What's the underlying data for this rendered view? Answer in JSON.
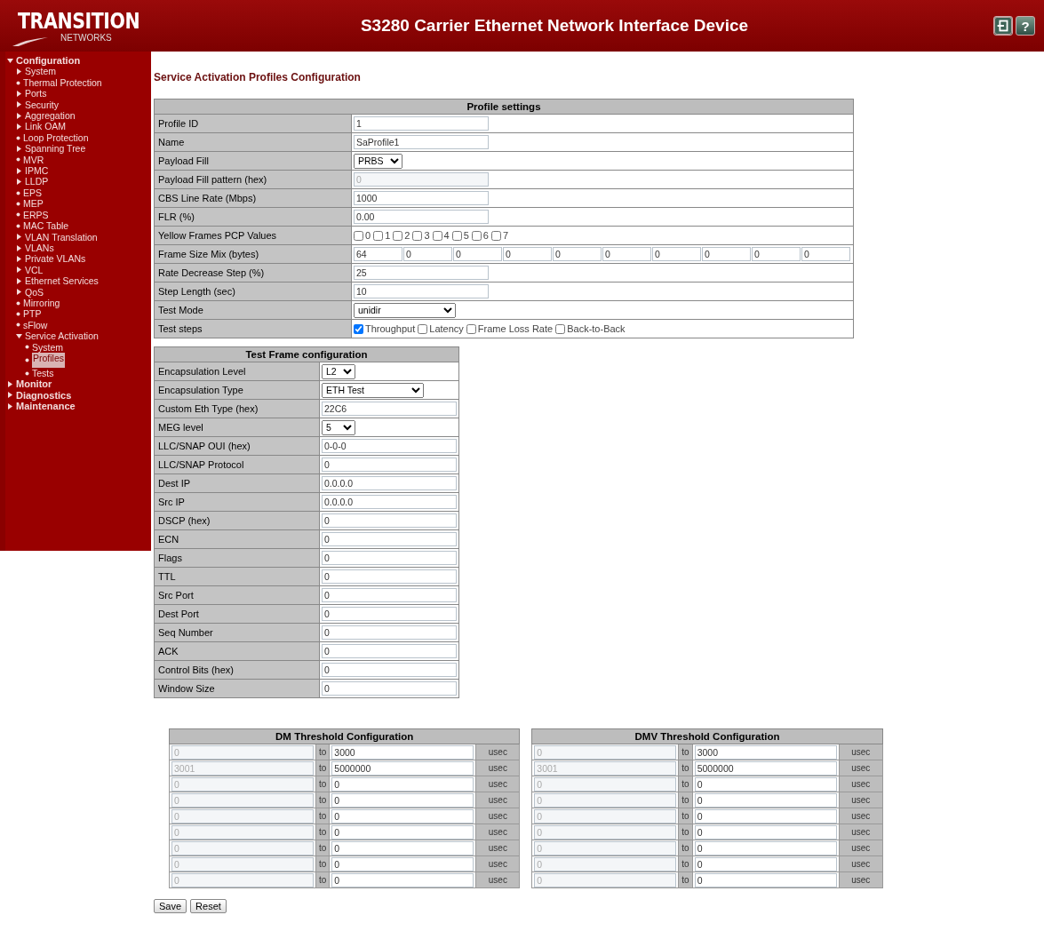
{
  "header": {
    "logo_main": "TRANSITION",
    "logo_sub": "NETWORKS",
    "title": "S3280 Carrier Ethernet Network Interface Device",
    "help": "?"
  },
  "sidebar": {
    "items": [
      {
        "label": "Configuration",
        "kind": "folder",
        "expanded": true,
        "selected": false,
        "children": [
          {
            "label": "System",
            "kind": "folder",
            "expanded": false,
            "selected": false
          },
          {
            "label": "Thermal Protection",
            "kind": "page",
            "selected": false
          },
          {
            "label": "Ports",
            "kind": "folder",
            "expanded": false,
            "selected": false
          },
          {
            "label": "Security",
            "kind": "folder",
            "expanded": false,
            "selected": false
          },
          {
            "label": "Aggregation",
            "kind": "folder",
            "expanded": false,
            "selected": false
          },
          {
            "label": "Link OAM",
            "kind": "folder",
            "expanded": false,
            "selected": false
          },
          {
            "label": "Loop Protection",
            "kind": "page",
            "selected": false
          },
          {
            "label": "Spanning Tree",
            "kind": "folder",
            "expanded": false,
            "selected": false
          },
          {
            "label": "MVR",
            "kind": "page",
            "selected": false
          },
          {
            "label": "IPMC",
            "kind": "folder",
            "expanded": false,
            "selected": false
          },
          {
            "label": "LLDP",
            "kind": "folder",
            "expanded": false,
            "selected": false
          },
          {
            "label": "EPS",
            "kind": "page",
            "selected": false
          },
          {
            "label": "MEP",
            "kind": "page",
            "selected": false
          },
          {
            "label": "ERPS",
            "kind": "page",
            "selected": false
          },
          {
            "label": "MAC Table",
            "kind": "page",
            "selected": false
          },
          {
            "label": "VLAN Translation",
            "kind": "folder",
            "expanded": false,
            "selected": false
          },
          {
            "label": "VLANs",
            "kind": "folder",
            "expanded": false,
            "selected": false
          },
          {
            "label": "Private VLANs",
            "kind": "folder",
            "expanded": false,
            "selected": false
          },
          {
            "label": "VCL",
            "kind": "folder",
            "expanded": false,
            "selected": false
          },
          {
            "label": "Ethernet Services",
            "kind": "folder",
            "expanded": false,
            "selected": false
          },
          {
            "label": "QoS",
            "kind": "folder",
            "expanded": false,
            "selected": false
          },
          {
            "label": "Mirroring",
            "kind": "page",
            "selected": false
          },
          {
            "label": "PTP",
            "kind": "page",
            "selected": false
          },
          {
            "label": "sFlow",
            "kind": "page",
            "selected": false
          },
          {
            "label": "Service Activation",
            "kind": "folder",
            "expanded": true,
            "selected": false,
            "children": [
              {
                "label": "System",
                "kind": "page",
                "selected": false
              },
              {
                "label": "Profiles",
                "kind": "page",
                "selected": true
              },
              {
                "label": "Tests",
                "kind": "page",
                "selected": false
              }
            ]
          }
        ]
      },
      {
        "label": "Monitor",
        "kind": "folder",
        "expanded": false,
        "selected": false
      },
      {
        "label": "Diagnostics",
        "kind": "folder",
        "expanded": false,
        "selected": false
      },
      {
        "label": "Maintenance",
        "kind": "folder",
        "expanded": false,
        "selected": false
      }
    ]
  },
  "page_title": "Service Activation Profiles Configuration",
  "profile": {
    "title": "Profile settings",
    "rows": [
      {
        "kind": "text",
        "label": "Profile ID",
        "value": "1",
        "disabled": false
      },
      {
        "kind": "text",
        "label": "Name",
        "value": "SaProfile1",
        "disabled": false
      },
      {
        "kind": "select",
        "label": "Payload Fill",
        "value": "PRBS"
      },
      {
        "kind": "text",
        "label": "Payload Fill pattern (hex)",
        "value": "0",
        "disabled": true
      },
      {
        "kind": "text",
        "label": "CBS Line Rate (Mbps)",
        "value": "1000",
        "disabled": false
      },
      {
        "kind": "text",
        "label": "FLR (%)",
        "value": "0.00",
        "disabled": false
      },
      {
        "kind": "checks",
        "label": "Yellow Frames PCP Values",
        "options": [
          {
            "label": "0",
            "checked": false
          },
          {
            "label": "1",
            "checked": false
          },
          {
            "label": "2",
            "checked": false
          },
          {
            "label": "3",
            "checked": false
          },
          {
            "label": "4",
            "checked": false
          },
          {
            "label": "5",
            "checked": false
          },
          {
            "label": "6",
            "checked": false
          },
          {
            "label": "7",
            "checked": false
          }
        ]
      },
      {
        "kind": "multi",
        "label": "Frame Size Mix (bytes)",
        "values": [
          "64",
          "0",
          "0",
          "0",
          "0",
          "0",
          "0",
          "0",
          "0",
          "0"
        ]
      },
      {
        "kind": "text",
        "label": "Rate Decrease Step (%)",
        "value": "25",
        "disabled": false
      },
      {
        "kind": "text",
        "label": "Step Length (sec)",
        "value": "10",
        "disabled": false
      },
      {
        "kind": "select",
        "label": "Test Mode",
        "value": "unidir"
      },
      {
        "kind": "checks",
        "label": "Test steps",
        "options": [
          {
            "label": "Throughput",
            "checked": true
          },
          {
            "label": "Latency",
            "checked": false
          },
          {
            "label": "Frame Loss Rate",
            "checked": false
          },
          {
            "label": "Back-to-Back",
            "checked": false
          }
        ]
      }
    ]
  },
  "test_frame": {
    "title": "Test Frame configuration",
    "rows": [
      {
        "kind": "select",
        "label": "Encapsulation Level",
        "value": "L2"
      },
      {
        "kind": "select",
        "label": "Encapsulation Type",
        "value": "ETH Test"
      },
      {
        "kind": "text",
        "label": "Custom Eth Type (hex)",
        "value": "22C6",
        "disabled": false
      },
      {
        "kind": "select",
        "label": "MEG level",
        "value": "5"
      },
      {
        "kind": "text",
        "label": "LLC/SNAP OUI (hex)",
        "value": "0-0-0",
        "disabled": false
      },
      {
        "kind": "text",
        "label": "LLC/SNAP Protocol",
        "value": "0",
        "disabled": false
      },
      {
        "kind": "text",
        "label": "Dest IP",
        "value": "0.0.0.0",
        "disabled": false
      },
      {
        "kind": "text",
        "label": "Src IP",
        "value": "0.0.0.0",
        "disabled": false
      },
      {
        "kind": "text",
        "label": "DSCP (hex)",
        "value": "0",
        "disabled": false
      },
      {
        "kind": "text",
        "label": "ECN",
        "value": "0",
        "disabled": false
      },
      {
        "kind": "text",
        "label": "Flags",
        "value": "0",
        "disabled": false
      },
      {
        "kind": "text",
        "label": "TTL",
        "value": "0",
        "disabled": false
      },
      {
        "kind": "text",
        "label": "Src Port",
        "value": "0",
        "disabled": false
      },
      {
        "kind": "text",
        "label": "Dest Port",
        "value": "0",
        "disabled": false
      },
      {
        "kind": "text",
        "label": "Seq Number",
        "value": "0",
        "disabled": false
      },
      {
        "kind": "text",
        "label": "ACK",
        "value": "0",
        "disabled": false
      },
      {
        "kind": "text",
        "label": "Control Bits (hex)",
        "value": "0",
        "disabled": false
      },
      {
        "kind": "text",
        "label": "Window Size",
        "value": "0",
        "disabled": false
      }
    ]
  },
  "thresholds": [
    {
      "title": "DM Threshold Configuration",
      "rows": [
        {
          "from": "0",
          "to_label": "to",
          "to": "3000",
          "unit": "usec"
        },
        {
          "from": "3001",
          "to_label": "to",
          "to": "5000000",
          "unit": "usec"
        },
        {
          "from": "0",
          "to_label": "to",
          "to": "0",
          "unit": "usec"
        },
        {
          "from": "0",
          "to_label": "to",
          "to": "0",
          "unit": "usec"
        },
        {
          "from": "0",
          "to_label": "to",
          "to": "0",
          "unit": "usec"
        },
        {
          "from": "0",
          "to_label": "to",
          "to": "0",
          "unit": "usec"
        },
        {
          "from": "0",
          "to_label": "to",
          "to": "0",
          "unit": "usec"
        },
        {
          "from": "0",
          "to_label": "to",
          "to": "0",
          "unit": "usec"
        },
        {
          "from": "0",
          "to_label": "to",
          "to": "0",
          "unit": "usec"
        }
      ]
    },
    {
      "title": "DMV Threshold Configuration",
      "rows": [
        {
          "from": "0",
          "to_label": "to",
          "to": "3000",
          "unit": "usec"
        },
        {
          "from": "3001",
          "to_label": "to",
          "to": "5000000",
          "unit": "usec"
        },
        {
          "from": "0",
          "to_label": "to",
          "to": "0",
          "unit": "usec"
        },
        {
          "from": "0",
          "to_label": "to",
          "to": "0",
          "unit": "usec"
        },
        {
          "from": "0",
          "to_label": "to",
          "to": "0",
          "unit": "usec"
        },
        {
          "from": "0",
          "to_label": "to",
          "to": "0",
          "unit": "usec"
        },
        {
          "from": "0",
          "to_label": "to",
          "to": "0",
          "unit": "usec"
        },
        {
          "from": "0",
          "to_label": "to",
          "to": "0",
          "unit": "usec"
        },
        {
          "from": "0",
          "to_label": "to",
          "to": "0",
          "unit": "usec"
        }
      ]
    }
  ],
  "buttons": [
    "Save",
    "Reset"
  ]
}
